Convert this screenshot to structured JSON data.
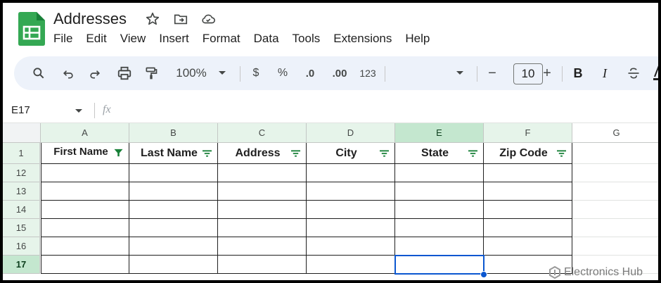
{
  "app": {
    "doc_title": "Addresses",
    "menu": [
      "File",
      "Edit",
      "View",
      "Insert",
      "Format",
      "Data",
      "Tools",
      "Extensions",
      "Help"
    ]
  },
  "toolbar": {
    "zoom": "100%",
    "currency": "$",
    "percent": "%",
    "decrease_decimal": ".0",
    "increase_decimal": ".00",
    "number_format": "123",
    "font_size": "10",
    "font_minus": "−",
    "font_plus": "+",
    "bold": "B",
    "italic": "I"
  },
  "formula_bar": {
    "name_box": "E17",
    "fx": "fx",
    "value": ""
  },
  "sheet": {
    "columns": [
      "A",
      "B",
      "C",
      "D",
      "E",
      "F",
      "G"
    ],
    "header_row_number": "1",
    "headers": [
      "First Name",
      "Last Name",
      "Address",
      "City",
      "State",
      "Zip Code"
    ],
    "row_numbers": [
      "12",
      "13",
      "14",
      "15",
      "16",
      "17"
    ],
    "selected_cell": "E17",
    "active_filter_column": "A"
  },
  "watermark": "Electronics Hub",
  "colors": {
    "accent_green": "#188038",
    "selection_blue": "#0b57d0",
    "toolbar_bg": "#edf2fa"
  }
}
